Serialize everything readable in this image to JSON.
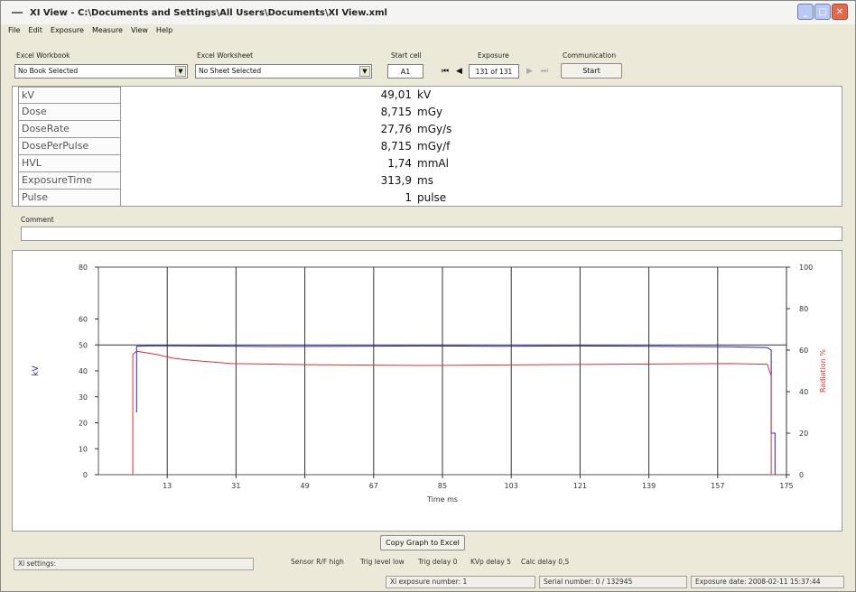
{
  "window": {
    "title": "XI View - C:\\Documents and Settings\\All Users\\Documents\\XI View.xml",
    "buttons": {
      "minimize": "_",
      "maximize": "□",
      "close": "✕"
    }
  },
  "menu": [
    "File",
    "Edit",
    "Exposure",
    "Measure",
    "View",
    "Help"
  ],
  "toolbar": {
    "workbook_label": "Excel Workbook",
    "workbook_value": "No Book Selected",
    "worksheet_label": "Excel Worksheet",
    "worksheet_value": "No Sheet Selected",
    "startcell_label": "Start cell",
    "startcell_value": "A1",
    "exposure_label": "Exposure",
    "exposure_value": "131 of 131",
    "communication_label": "Communication",
    "start_button": "Start"
  },
  "readings": [
    {
      "label": "kV",
      "value": "49,01",
      "unit": "kV"
    },
    {
      "label": "Dose",
      "value": "8,715",
      "unit": "mGy"
    },
    {
      "label": "DoseRate",
      "value": "27,76",
      "unit": "mGy/s"
    },
    {
      "label": "DosePerPulse",
      "value": "8,715",
      "unit": "mGy/f"
    },
    {
      "label": "HVL",
      "value": "1,74",
      "unit": "mmAl"
    },
    {
      "label": "ExposureTime",
      "value": "313,9",
      "unit": "ms"
    },
    {
      "label": "Pulse",
      "value": "1",
      "unit": "pulse"
    }
  ],
  "comment_label": "Comment",
  "chart_data": {
    "type": "line",
    "xlabel": "Time ms",
    "ylabel": "kV",
    "y2label": "Radiation %",
    "xlim": [
      -5,
      175
    ],
    "ylim": [
      0,
      80
    ],
    "y2lim": [
      0,
      100
    ],
    "xticks": [
      13,
      31,
      49,
      67,
      85,
      103,
      121,
      139,
      157,
      175
    ],
    "yticks": [
      0,
      10,
      20,
      30,
      40,
      50,
      60,
      80
    ],
    "y2ticks": [
      0,
      20,
      40,
      60,
      80,
      100
    ],
    "grid": true,
    "series": [
      {
        "axis": "left",
        "color": "#2222cc",
        "x": [
          5,
          5,
          8,
          20,
          40,
          60,
          80,
          100,
          120,
          140,
          160,
          170,
          171,
          171,
          172,
          172
        ],
        "y": [
          24,
          49.5,
          49.7,
          49.6,
          49.4,
          49.5,
          49.6,
          49.5,
          49.6,
          49.5,
          49.3,
          49.0,
          48.0,
          16,
          16,
          0
        ]
      },
      {
        "axis": "right",
        "color": "#dd3333",
        "x": [
          4,
          4,
          5,
          10,
          15,
          20,
          30,
          50,
          80,
          110,
          140,
          160,
          170,
          171,
          171,
          172
        ],
        "y": [
          0,
          58,
          59.5,
          58,
          56,
          55,
          53.5,
          53,
          52.6,
          53,
          53.3,
          53.5,
          53.2,
          47.5,
          0,
          0
        ]
      }
    ]
  },
  "copy_button": "Copy Graph to Excel",
  "status": {
    "settings": "Xi settings:",
    "sensor": "Sensor R/F high",
    "trig_level": "Trig level low",
    "trig_delay": "Trig delay 0",
    "kvp_delay": "KVp delay 5",
    "calc_delay": "Calc delay 0,5",
    "exposure_number": "Xi exposure number: 1",
    "serial_number": "Serial number: 0 / 132945",
    "exposure_date": "Exposure date: 2008-02-11 15:37:44"
  }
}
